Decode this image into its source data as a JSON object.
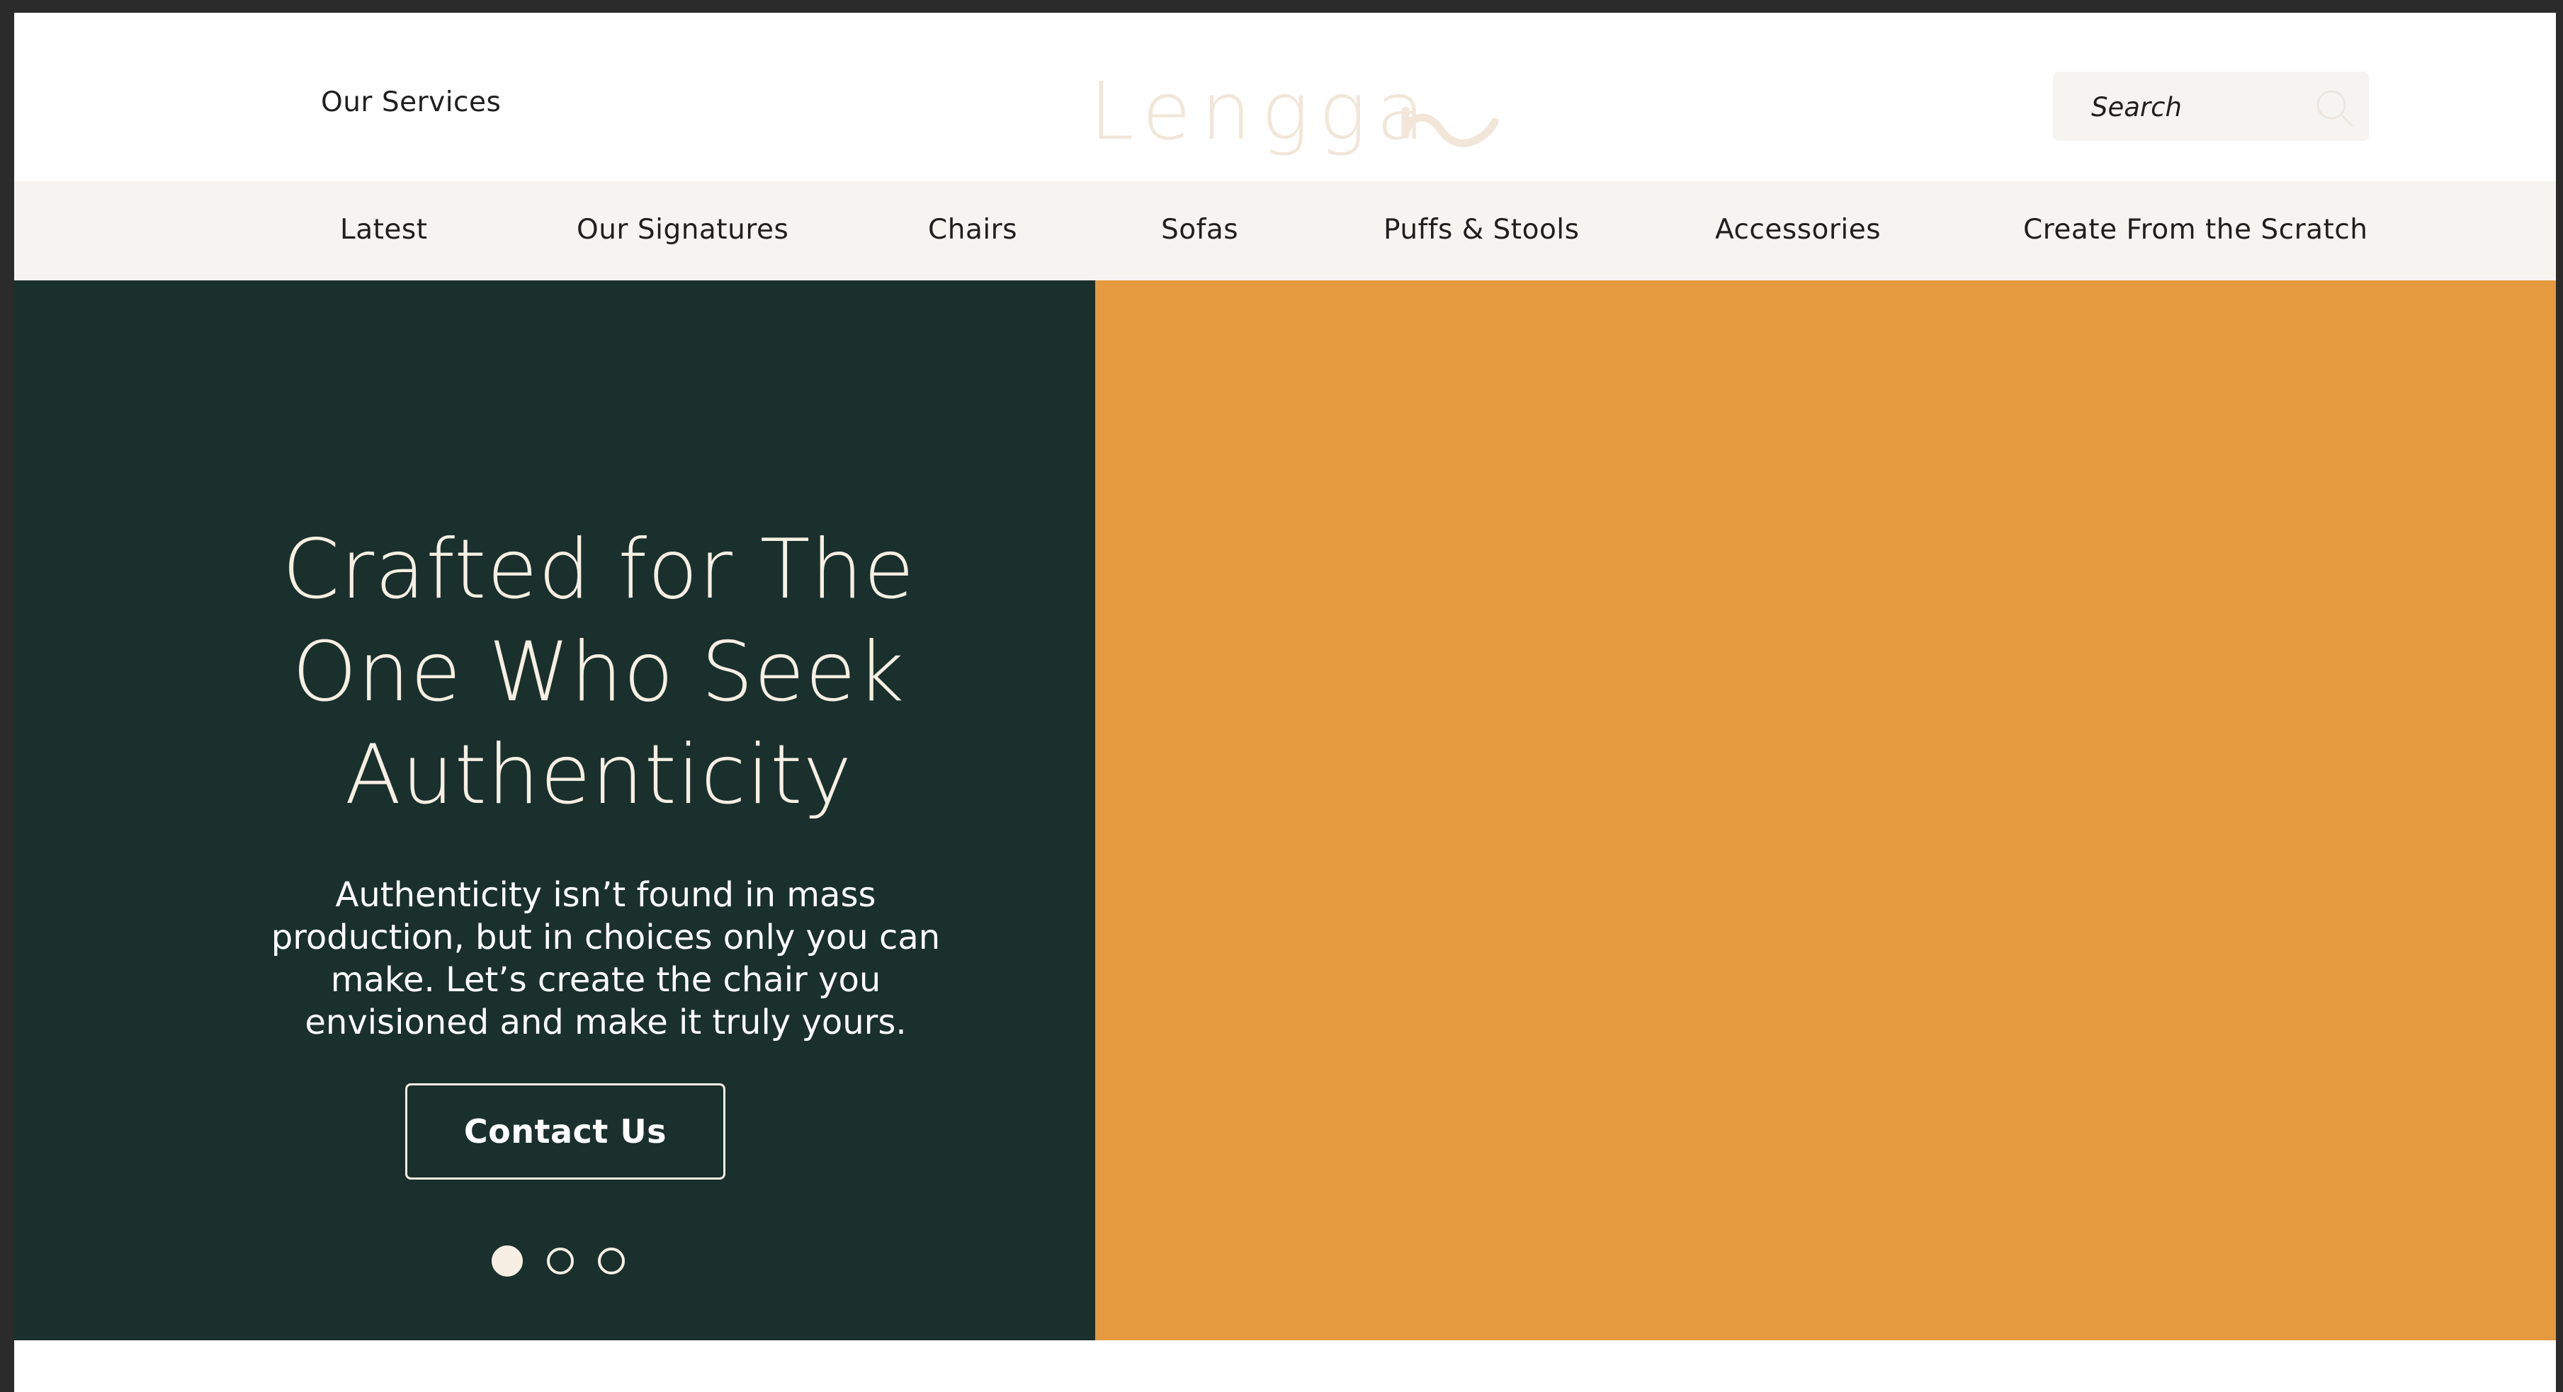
{
  "header": {
    "services_label": "Our Services",
    "logo_text": "Lenggah",
    "logo_main": "Lengga",
    "search": {
      "placeholder": "Search",
      "value": ""
    }
  },
  "nav": {
    "items": [
      {
        "label": "Latest"
      },
      {
        "label": "Our Signatures"
      },
      {
        "label": "Chairs"
      },
      {
        "label": "Sofas"
      },
      {
        "label": "Puffs & Stools"
      },
      {
        "label": "Accessories"
      },
      {
        "label": "Create From the Scratch"
      }
    ]
  },
  "hero": {
    "title_line1": "Crafted for The",
    "title_line2": "One Who Seek",
    "title_line3": "Authenticity",
    "description": "Authenticity isn’t found in mass production, but in choices only you can make. Let’s create the chair you envisioned and make it truly yours.",
    "cta_label": "Contact Us",
    "slides_total": 3,
    "active_slide": 1
  },
  "colors": {
    "hero_left_bg": "#1a302d",
    "hero_right_bg": "#e59a3f",
    "nav_bg": "#f6f4f1",
    "logo_color": "#f1e6d8",
    "accent_cream": "#f7efe3"
  },
  "icons": {
    "search": "search-icon",
    "logo_swoosh": "swoosh-icon"
  }
}
